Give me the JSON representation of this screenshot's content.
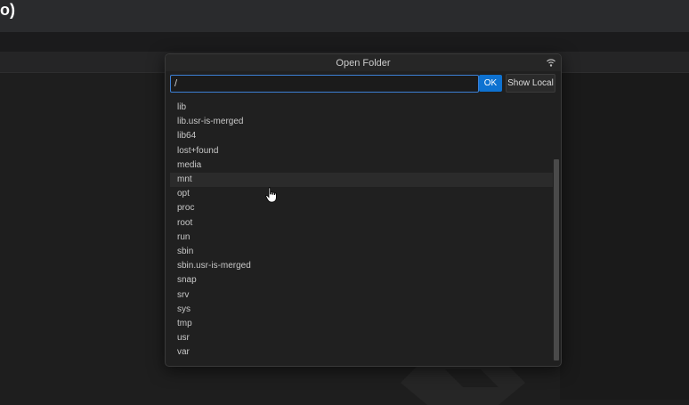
{
  "app": {
    "title_fragment": "o)"
  },
  "dialog": {
    "title": "Open Folder",
    "path_value": "/",
    "ok_label": "OK",
    "show_local_label": "Show Local",
    "icons": {
      "header": "broadcast-icon",
      "pointer": "hand-cursor-icon"
    },
    "hovered_item": "mnt",
    "items": [
      {
        "label": "lib"
      },
      {
        "label": "lib.usr-is-merged"
      },
      {
        "label": "lib64"
      },
      {
        "label": "lost+found"
      },
      {
        "label": "media"
      },
      {
        "label": "mnt"
      },
      {
        "label": "opt"
      },
      {
        "label": "proc"
      },
      {
        "label": "root"
      },
      {
        "label": "run"
      },
      {
        "label": "sbin"
      },
      {
        "label": "sbin.usr-is-merged"
      },
      {
        "label": "snap"
      },
      {
        "label": "srv"
      },
      {
        "label": "sys"
      },
      {
        "label": "tmp"
      },
      {
        "label": "usr"
      },
      {
        "label": "var"
      }
    ]
  },
  "colors": {
    "accent": "#0e72d1",
    "input_border": "#3c7fd4"
  }
}
